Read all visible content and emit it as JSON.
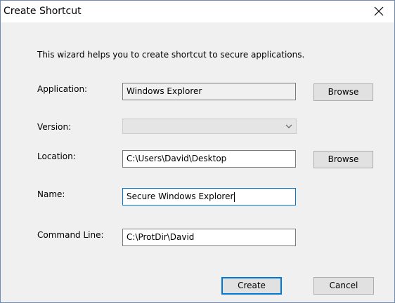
{
  "window": {
    "title": "Create Shortcut",
    "close_icon": "close-icon"
  },
  "dialog": {
    "intro": "This wizard helps you to create shortcut to secure applications.",
    "application": {
      "label": "Application:",
      "value": "Windows Explorer",
      "browse_label": "Browse"
    },
    "version": {
      "label": "Version:",
      "value": "",
      "dropdown_icon": "chevron-down-icon"
    },
    "location": {
      "label": "Location:",
      "value": "C:\\Users\\David\\Desktop",
      "browse_label": "Browse"
    },
    "name": {
      "label": "Name:",
      "value": "Secure Windows Explorer"
    },
    "command_line": {
      "label": "Command Line:",
      "value": "C:\\ProtDir\\David"
    },
    "buttons": {
      "create_label": "Create",
      "cancel_label": "Cancel"
    }
  },
  "colors": {
    "window_background": "#f0f0f0",
    "title_background": "#ffffff",
    "focus_border": "#0078d7",
    "button_face": "#e1e1e1"
  }
}
